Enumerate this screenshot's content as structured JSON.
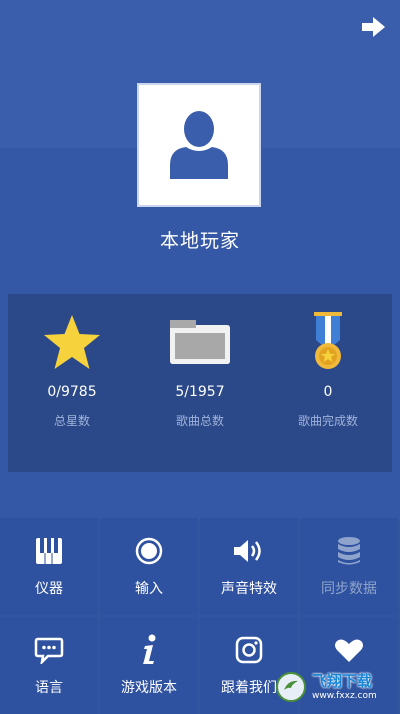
{
  "profile": {
    "player_name": "本地玩家",
    "avatar_icon": "user-icon",
    "logout_icon": "arrow-right-icon"
  },
  "stats": [
    {
      "value": "0/9785",
      "label": "总星数",
      "icon": "star-icon"
    },
    {
      "value": "5/1957",
      "label": "歌曲总数",
      "icon": "folder-icon"
    },
    {
      "value": "0",
      "label": "歌曲完成数",
      "icon": "medal-icon"
    }
  ],
  "menu": [
    {
      "label": "仪器",
      "icon": "piano-icon",
      "enabled": true
    },
    {
      "label": "输入",
      "icon": "record-icon",
      "enabled": true
    },
    {
      "label": "声音特效",
      "icon": "speaker-icon",
      "enabled": true
    },
    {
      "label": "同步数据",
      "icon": "database-icon",
      "enabled": false
    },
    {
      "label": "语言",
      "icon": "chat-bubble-icon",
      "enabled": true
    },
    {
      "label": "游戏版本",
      "icon": "info-icon",
      "enabled": true
    },
    {
      "label": "跟着我们",
      "icon": "instagram-icon",
      "enabled": true
    },
    {
      "label": "",
      "icon": "heart-icon",
      "enabled": true
    }
  ],
  "watermark": {
    "title": "飞翔下载",
    "subtitle": "www.fxxz.com"
  },
  "colors": {
    "background": "#3255a0",
    "panel": "#2b4888",
    "star": "#f6d33c",
    "medal_ribbon": "#3f7fd6",
    "medal_gold": "#f0b93a"
  }
}
